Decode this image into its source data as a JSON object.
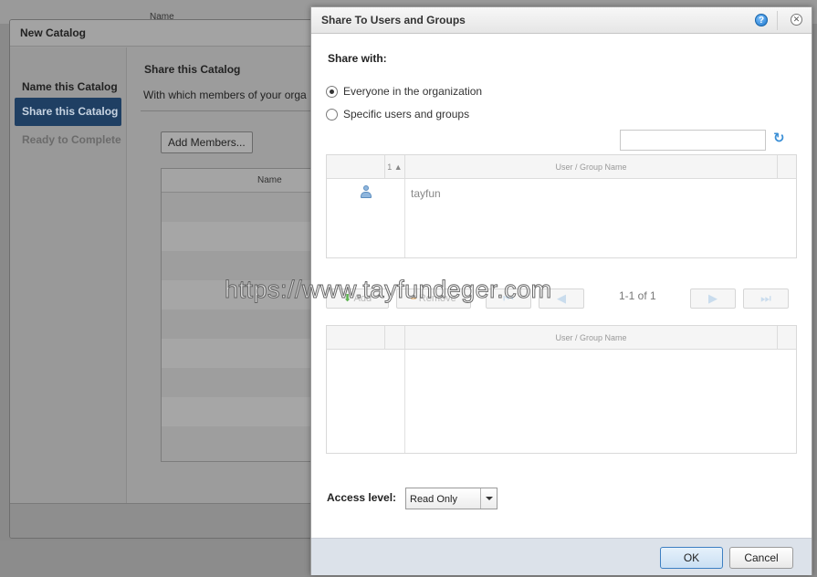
{
  "background": {
    "column_header": "Name"
  },
  "wizard": {
    "title": "New Catalog",
    "steps": [
      {
        "label": "Name this Catalog",
        "state": "done"
      },
      {
        "label": "Share this Catalog",
        "state": "active"
      },
      {
        "label": "Ready to Complete",
        "state": "disabled"
      }
    ],
    "heading": "Share this Catalog",
    "description": "With which members of your orga",
    "add_members_label": "Add Members...",
    "table_header": "Name"
  },
  "dialog": {
    "title": "Share To Users and Groups",
    "help_icon": "?",
    "close_icon": "✕",
    "share_with_label": "Share with:",
    "options": [
      {
        "label": "Everyone in the organization",
        "checked": true
      },
      {
        "label": "Specific users and groups",
        "checked": false
      }
    ],
    "search": {
      "value": "",
      "placeholder": ""
    },
    "available_grid": {
      "sort_column": "1 ▲",
      "name_column": "User / Group Name",
      "rows": [
        {
          "name": "tayfun",
          "icon": "user-icon"
        }
      ]
    },
    "toolbar": {
      "add_label": "Add",
      "remove_label": "Remove",
      "pager_text": "1-1 of 1"
    },
    "selected_grid": {
      "name_column": "User / Group Name",
      "rows": []
    },
    "access_level_label": "Access level:",
    "access_level_value": "Read Only",
    "ok_label": "OK",
    "cancel_label": "Cancel"
  },
  "watermark": "https://www.tayfundeger.com",
  "colors": {
    "active_step": "#1f3f63",
    "ok_border": "#3d7fc2",
    "footer_bg": "#dce2ea"
  }
}
